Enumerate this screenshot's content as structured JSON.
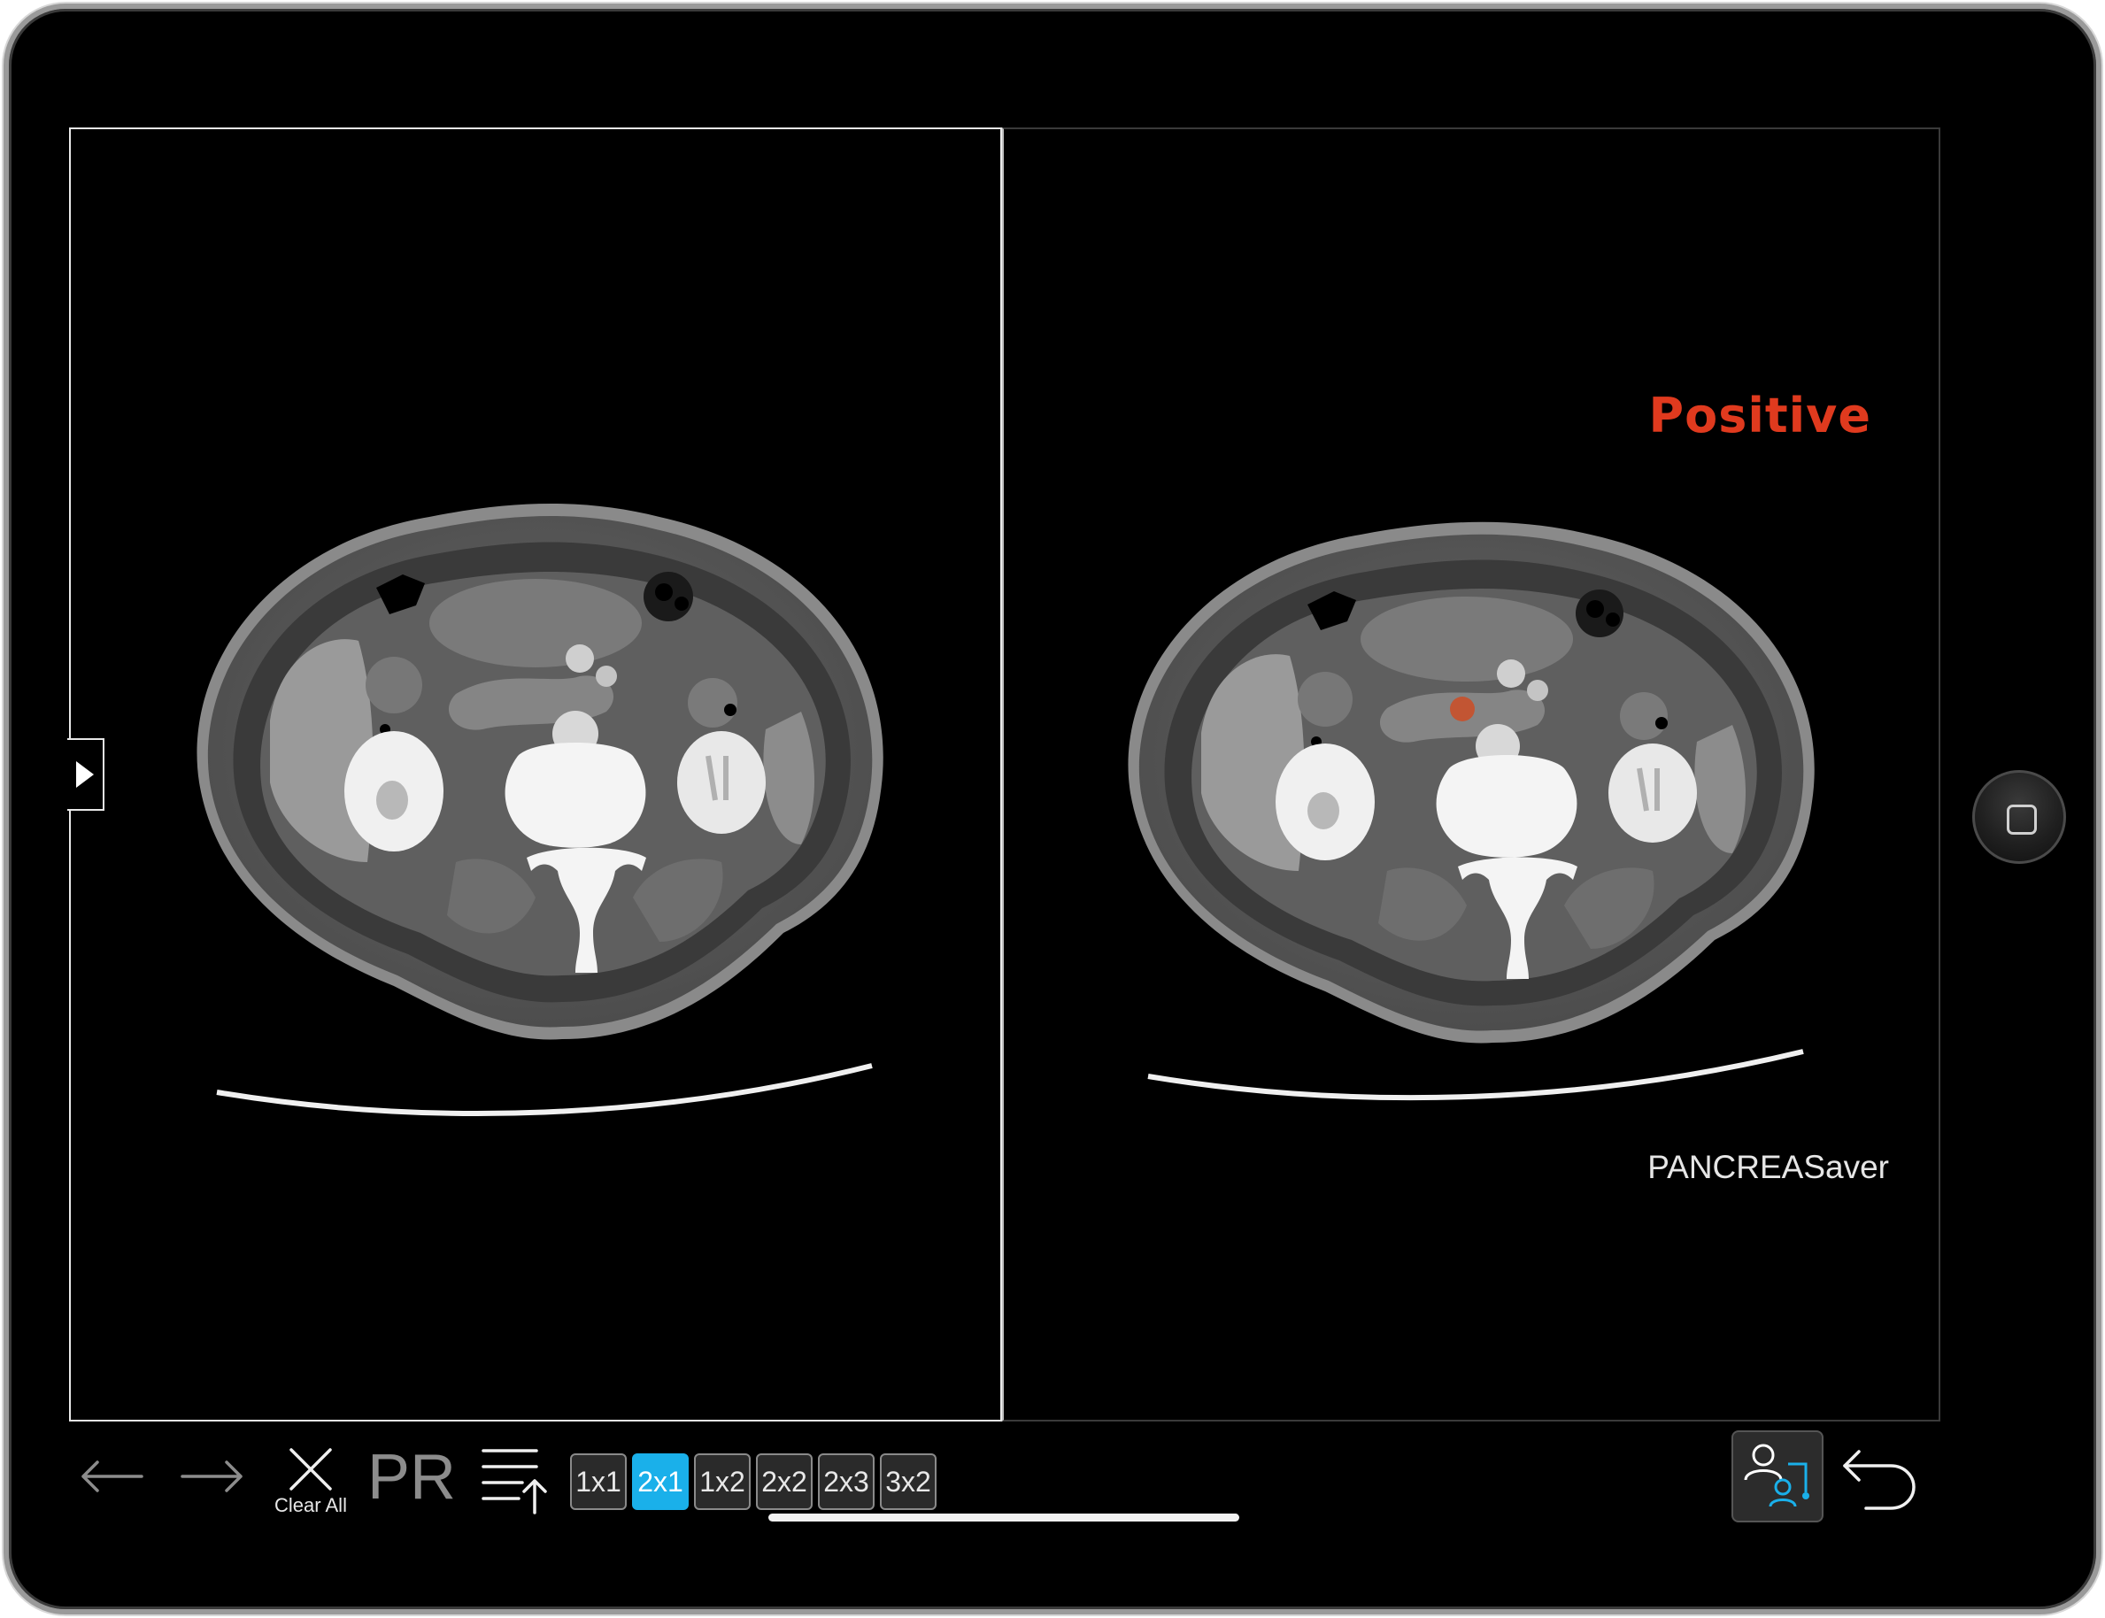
{
  "viewer": {
    "layout_options": [
      "1x1",
      "2x1",
      "1x2",
      "2x2",
      "2x3",
      "3x2"
    ],
    "active_layout": "2x1",
    "accent_color": "#1ab0ea"
  },
  "right_pane": {
    "result_label": "Positive",
    "result_color": "#e03a1e",
    "brand_label": "PANCREASaver"
  },
  "toolbar": {
    "back_icon": "arrow-left-icon",
    "forward_icon": "arrow-right-icon",
    "clear_all_label": "Clear All",
    "pr_label": "PR",
    "sort_icon": "sort-up-icon",
    "user_switch_icon": "user-switch-icon",
    "undo_icon": "undo-icon"
  }
}
